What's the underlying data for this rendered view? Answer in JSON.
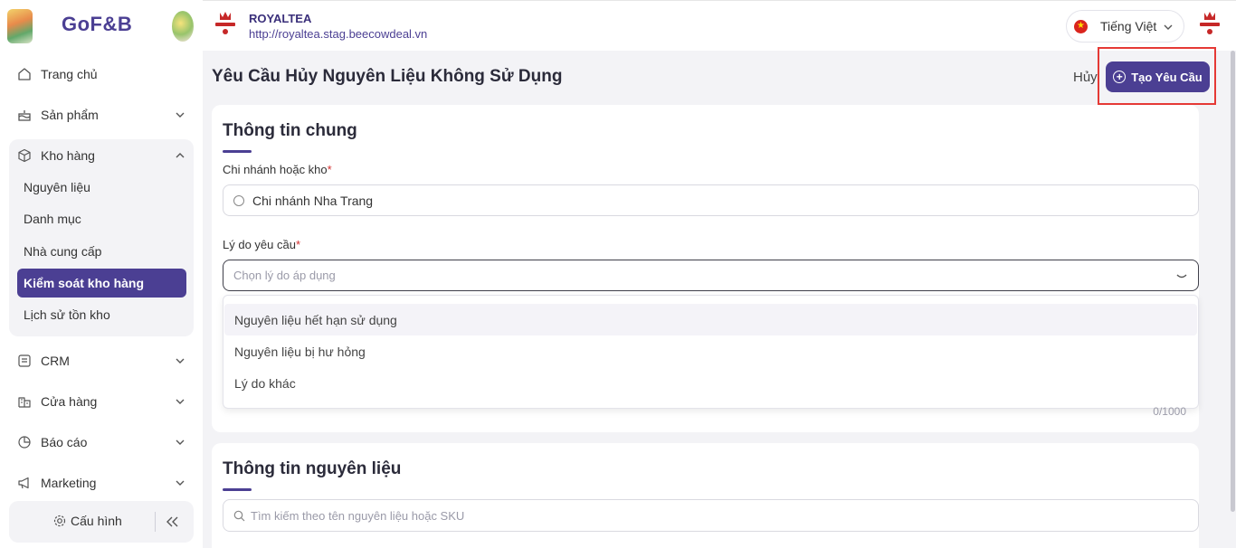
{
  "brand": {
    "logo_text": "GoF&B"
  },
  "sidebar": {
    "items": [
      {
        "label": "Trang chủ"
      },
      {
        "label": "Sản phẩm"
      },
      {
        "label": "Kho hàng"
      },
      {
        "label": "CRM"
      },
      {
        "label": "Cửa hàng"
      },
      {
        "label": "Báo cáo"
      },
      {
        "label": "Marketing"
      }
    ],
    "kho_sub": [
      {
        "label": "Nguyên liệu"
      },
      {
        "label": "Danh mục"
      },
      {
        "label": "Nhà cung cấp"
      },
      {
        "label": "Kiểm soát kho hàng",
        "active": true
      },
      {
        "label": "Lịch sử tồn kho"
      }
    ],
    "config_label": "Cấu hình"
  },
  "header": {
    "store_name": "ROYALTEA",
    "store_url": "http://royaltea.stag.beecowdeal.vn",
    "language": "Tiếng Việt"
  },
  "page": {
    "title": "Yêu Cầu Hủy Nguyên Liệu Không Sử Dụng",
    "cancel_label": "Hủy",
    "create_label": "Tạo Yêu Cầu"
  },
  "general": {
    "title": "Thông tin chung",
    "branch_label": "Chi nhánh hoặc kho",
    "branch_value": "Chi nhánh Nha Trang",
    "reason_label": "Lý do yêu cầu",
    "reason_placeholder": "Chọn lý do áp dụng",
    "reason_options": [
      "Nguyên liệu hết hạn sử dụng",
      "Nguyên liệu bị hư hỏng",
      "Lý do khác"
    ],
    "char_counter": "0/1000",
    "required_mark": "*"
  },
  "materials": {
    "title": "Thông tin nguyên liệu",
    "search_placeholder": "Tìm kiếm theo tên nguyên liệu hoặc SKU"
  },
  "colors": {
    "primary": "#4b3f93",
    "highlight": "#e53935",
    "required": "#d32f2f"
  }
}
